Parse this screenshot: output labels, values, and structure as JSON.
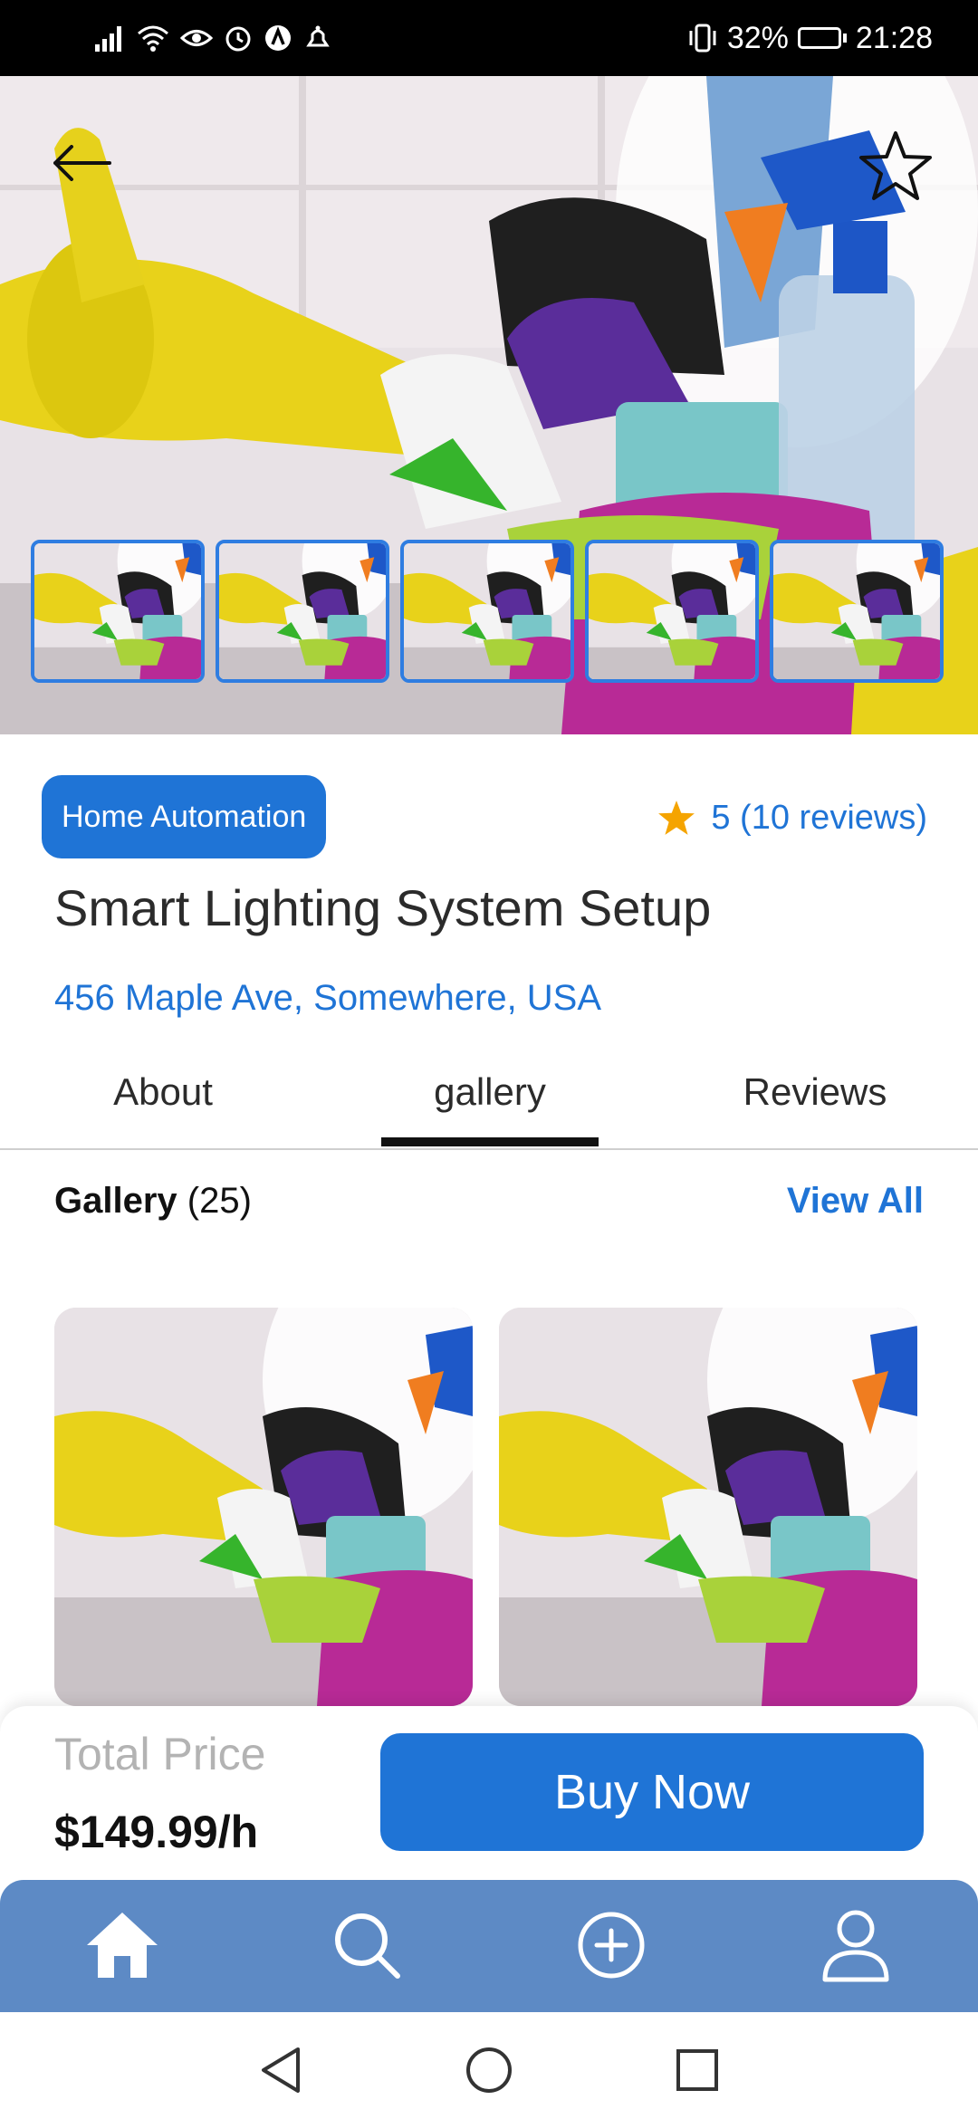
{
  "status_bar": {
    "battery_percent": "32%",
    "time": "21:28"
  },
  "hero": {
    "back_icon": "arrow-left-icon",
    "favorite_icon": "star-outline-icon",
    "thumbnail_count": 5
  },
  "service": {
    "category": "Home Automation",
    "rating": "5",
    "reviews": "(10 reviews)",
    "title": "Smart Lighting System Setup",
    "address": "456 Maple Ave, Somewhere, USA"
  },
  "tabs": [
    {
      "label": "About"
    },
    {
      "label": "gallery"
    },
    {
      "label": "Reviews"
    }
  ],
  "active_tab": "gallery",
  "gallery": {
    "heading": "Gallery",
    "count": "(25)",
    "view_all": "View All"
  },
  "purchase": {
    "price_label": "Total Price",
    "price_value": "$149.99/h",
    "buy_label": "Buy Now"
  },
  "bottom_nav": [
    "home-icon",
    "search-icon",
    "add-circle-icon",
    "profile-icon"
  ],
  "system_nav": [
    "back-triangle-icon",
    "home-circle-icon",
    "recents-square-icon"
  ],
  "colors": {
    "accent": "#1f74d6",
    "bottom_nav": "#5d8ac5",
    "rating_star": "#f5a400"
  }
}
